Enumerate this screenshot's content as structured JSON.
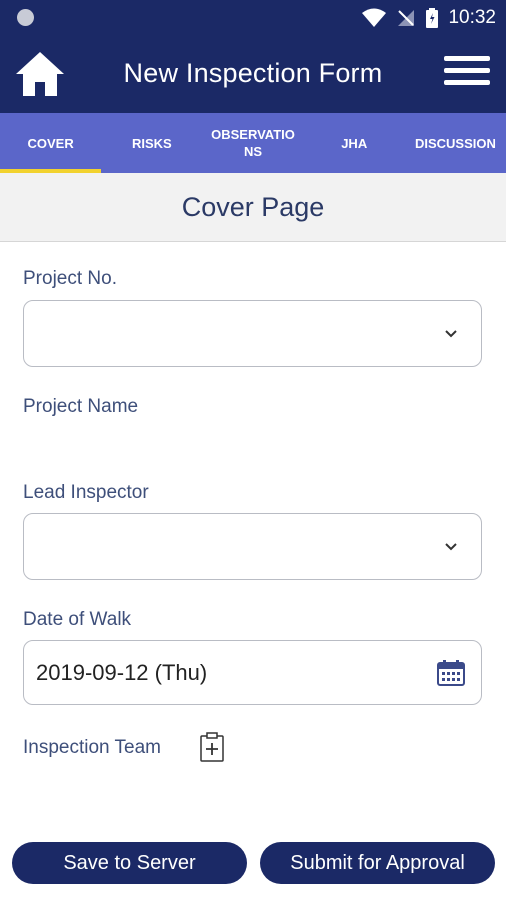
{
  "status_bar": {
    "time": "10:32"
  },
  "app_bar": {
    "title": "New Inspection Form"
  },
  "tabs": [
    {
      "label": "COVER",
      "active": true
    },
    {
      "label": "RISKS",
      "active": false
    },
    {
      "label": "OBSERVATIONS",
      "active": false
    },
    {
      "label": "JHA",
      "active": false
    },
    {
      "label": "DISCUSSION",
      "active": false
    }
  ],
  "section": {
    "title": "Cover Page"
  },
  "form": {
    "project_no_label": "Project No.",
    "project_name_label": "Project Name",
    "lead_inspector_label": "Lead Inspector",
    "date_label": "Date of Walk",
    "date_value": "2019-09-12 (Thu)",
    "team_label": "Inspection Team"
  },
  "buttons": {
    "save": "Save to Server",
    "submit": "Submit for Approval"
  },
  "colors": {
    "primary": "#1b2966",
    "tab_bar": "#5b66c9",
    "tab_indicator": "#f2d22e"
  }
}
